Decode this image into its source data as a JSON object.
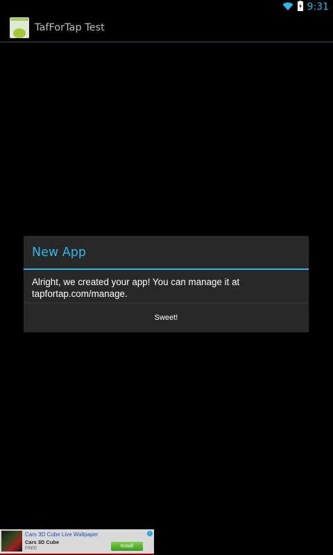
{
  "status_bar": {
    "time": "9:31",
    "wifi_icon": "wifi-icon",
    "battery_icon": "battery-charging-icon"
  },
  "action_bar": {
    "app_icon": "android-app-icon",
    "title": "TafForTap Test"
  },
  "dialog": {
    "title": "New App",
    "message": "Alright, we created your app! You can manage it at tapfortap.com/manage.",
    "button_label": "Sweet!",
    "accent_color": "#33b5e5"
  },
  "ad": {
    "title": "Cars 3D Cube Live Wallpaper",
    "subtitle": "Cars 3D Cube",
    "price": "FREE",
    "install_label": "Install",
    "info_icon": "info-icon"
  },
  "colors": {
    "background": "#000000",
    "dialog_bg": "#282828",
    "accent": "#33b5e5"
  }
}
